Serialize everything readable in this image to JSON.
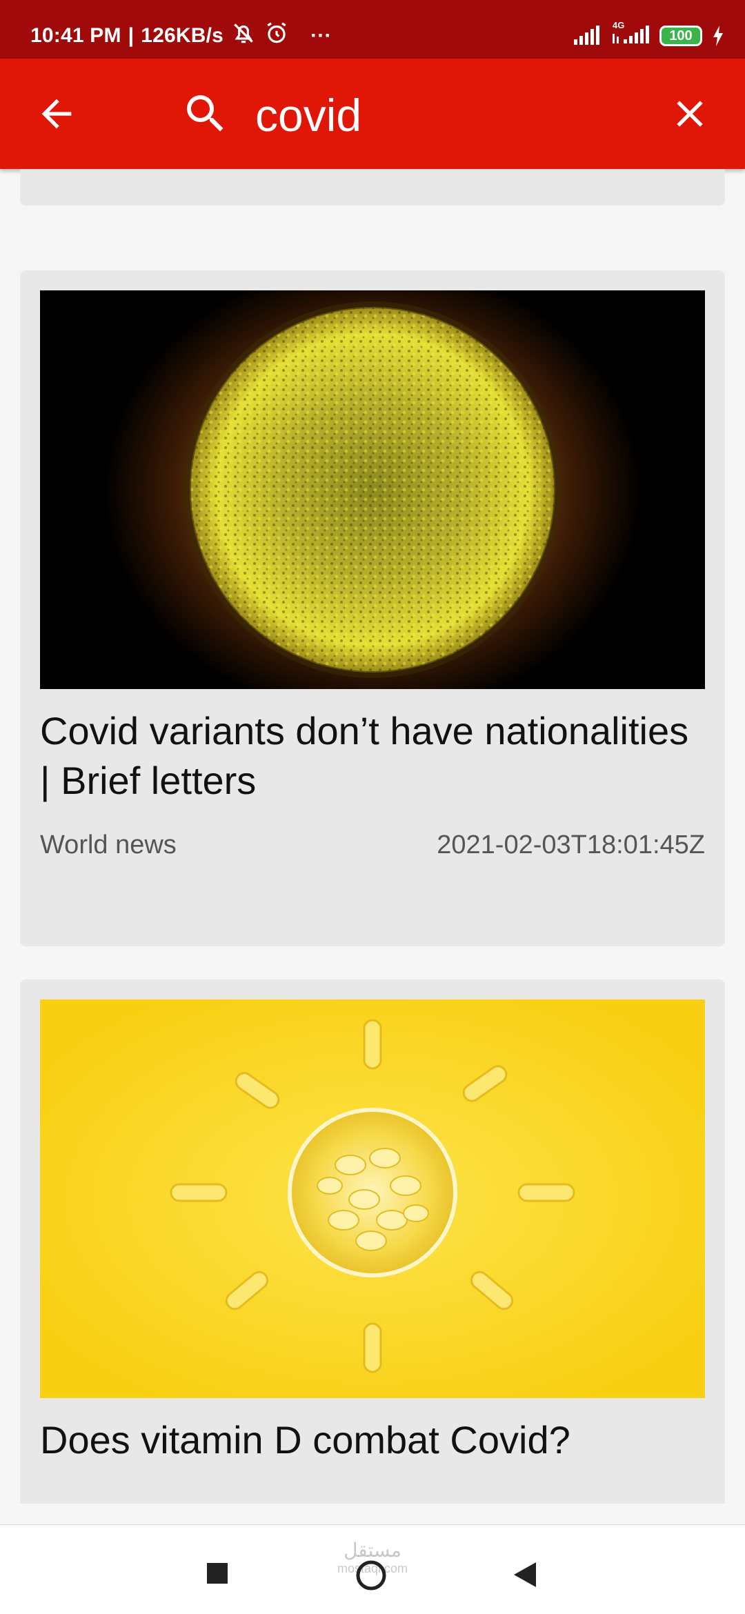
{
  "status_bar": {
    "time": "10:41 PM",
    "separator": "|",
    "speed": "126KB/s",
    "more": "···",
    "network_label": "4G",
    "battery": "100"
  },
  "search": {
    "query": "covid"
  },
  "articles": [
    {
      "title": "Covid variants don’t have nationalities | Brief letters",
      "section": "World news",
      "date": "2021-02-03T18:01:45Z",
      "image": "coronavirus-microscope-image"
    },
    {
      "title": "Does vitamin D combat Covid?",
      "image": "vitamin-d-capsules-image"
    }
  ],
  "watermark": {
    "text_ar": "مستقل",
    "text_en": "mostaql.com"
  },
  "colors": {
    "status_bar": "#a10a0a",
    "app_bar": "#e01606",
    "card_bg": "#e8e8e8"
  }
}
